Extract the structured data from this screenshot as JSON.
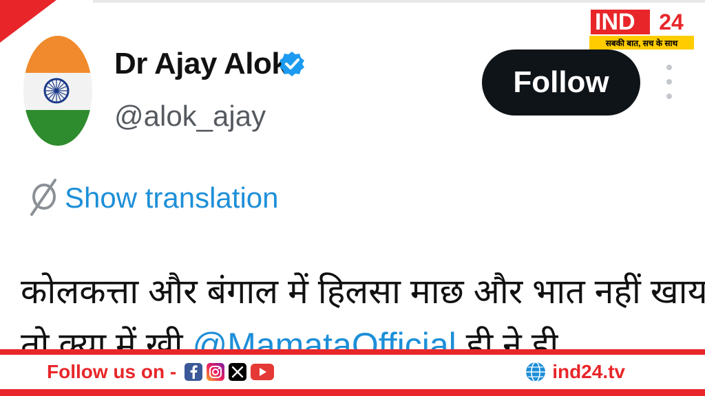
{
  "profile": {
    "name": "Dr Ajay Alok",
    "handle": "@alok_ajay",
    "follow_label": "Follow",
    "verified_icon": "verified-badge-icon",
    "more_icon": "more-vertical-icon"
  },
  "tweet": {
    "translate_label": "Show translation",
    "line1": "कोलकत्ता और बंगाल में हिलसा माछ और भात नहीं खाया",
    "line2_start": "तो      क्या     में      खी  ",
    "line2_mention": "@MamataOfficial",
    "line2_end": "  ही ने ही"
  },
  "brand": {
    "logo_main": "IND",
    "logo_number": "24",
    "logo_tagline": "सबकी बात, सच के साथ",
    "follow_us": "Follow us on -",
    "social_icons": [
      "facebook-icon",
      "instagram-icon",
      "x-icon",
      "youtube-icon"
    ],
    "website": "ind24.tv"
  },
  "colors": {
    "accent_red": "#e8262a",
    "link_blue": "#1d8fd8",
    "follow_button": "#0f1419",
    "tagline_yellow": "#ffcc00"
  }
}
